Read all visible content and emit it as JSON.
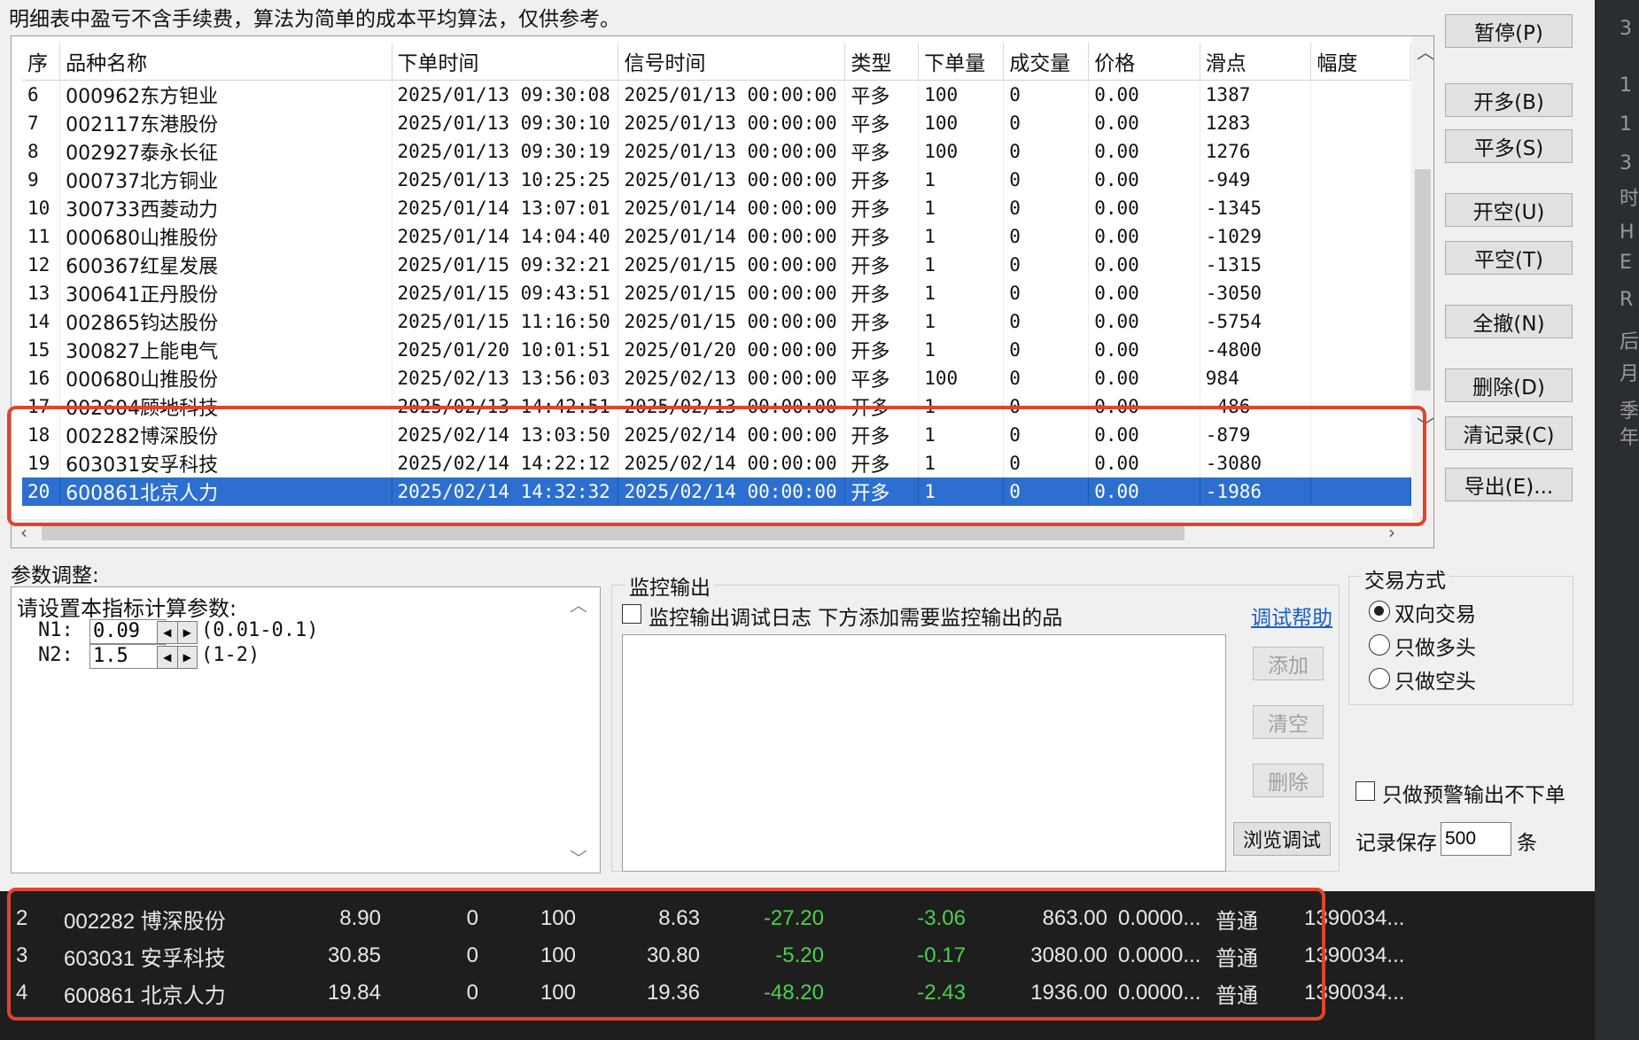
{
  "note": "明细表中盈亏不含手续费，算法为简单的成本平均算法，仅供参考。",
  "grid": {
    "headers": [
      "序",
      "品种名称",
      "下单时间",
      "信号时间",
      "类型",
      "下单量",
      "成交量",
      "价格",
      "滑点",
      "幅度"
    ],
    "rows": [
      {
        "idx": "6",
        "name": "000962东方钽业",
        "order_time": "2025/01/13 09:30:08",
        "signal_time": "2025/01/13 00:00:00",
        "type": "平多",
        "qty": "100",
        "filled": "0",
        "price": "0.00",
        "slip": "1387",
        "range": ""
      },
      {
        "idx": "7",
        "name": "002117东港股份",
        "order_time": "2025/01/13 09:30:10",
        "signal_time": "2025/01/13 00:00:00",
        "type": "平多",
        "qty": "100",
        "filled": "0",
        "price": "0.00",
        "slip": "1283",
        "range": ""
      },
      {
        "idx": "8",
        "name": "002927泰永长征",
        "order_time": "2025/01/13 09:30:19",
        "signal_time": "2025/01/13 00:00:00",
        "type": "平多",
        "qty": "100",
        "filled": "0",
        "price": "0.00",
        "slip": "1276",
        "range": ""
      },
      {
        "idx": "9",
        "name": "000737北方铜业",
        "order_time": "2025/01/13 10:25:25",
        "signal_time": "2025/01/13 00:00:00",
        "type": "开多",
        "qty": "1",
        "filled": "0",
        "price": "0.00",
        "slip": "-949",
        "range": ""
      },
      {
        "idx": "10",
        "name": "300733西菱动力",
        "order_time": "2025/01/14 13:07:01",
        "signal_time": "2025/01/14 00:00:00",
        "type": "开多",
        "qty": "1",
        "filled": "0",
        "price": "0.00",
        "slip": "-1345",
        "range": ""
      },
      {
        "idx": "11",
        "name": "000680山推股份",
        "order_time": "2025/01/14 14:04:40",
        "signal_time": "2025/01/14 00:00:00",
        "type": "开多",
        "qty": "1",
        "filled": "0",
        "price": "0.00",
        "slip": "-1029",
        "range": ""
      },
      {
        "idx": "12",
        "name": "600367红星发展",
        "order_time": "2025/01/15 09:32:21",
        "signal_time": "2025/01/15 00:00:00",
        "type": "开多",
        "qty": "1",
        "filled": "0",
        "price": "0.00",
        "slip": "-1315",
        "range": ""
      },
      {
        "idx": "13",
        "name": "300641正丹股份",
        "order_time": "2025/01/15 09:43:51",
        "signal_time": "2025/01/15 00:00:00",
        "type": "开多",
        "qty": "1",
        "filled": "0",
        "price": "0.00",
        "slip": "-3050",
        "range": ""
      },
      {
        "idx": "14",
        "name": "002865钧达股份",
        "order_time": "2025/01/15 11:16:50",
        "signal_time": "2025/01/15 00:00:00",
        "type": "开多",
        "qty": "1",
        "filled": "0",
        "price": "0.00",
        "slip": "-5754",
        "range": ""
      },
      {
        "idx": "15",
        "name": "300827上能电气",
        "order_time": "2025/01/20 10:01:51",
        "signal_time": "2025/01/20 00:00:00",
        "type": "开多",
        "qty": "1",
        "filled": "0",
        "price": "0.00",
        "slip": "-4800",
        "range": ""
      },
      {
        "idx": "16",
        "name": "000680山推股份",
        "order_time": "2025/02/13 13:56:03",
        "signal_time": "2025/02/13 00:00:00",
        "type": "平多",
        "qty": "100",
        "filled": "0",
        "price": "0.00",
        "slip": "984",
        "range": ""
      },
      {
        "idx": "17",
        "name": "002604顾地科技",
        "order_time": "2025/02/13 14:42:51",
        "signal_time": "2025/02/13 00:00:00",
        "type": "开多",
        "qty": "1",
        "filled": "0",
        "price": "0.00",
        "slip": "-486",
        "range": ""
      },
      {
        "idx": "18",
        "name": "002282博深股份",
        "order_time": "2025/02/14 13:03:50",
        "signal_time": "2025/02/14 00:00:00",
        "type": "开多",
        "qty": "1",
        "filled": "0",
        "price": "0.00",
        "slip": "-879",
        "range": ""
      },
      {
        "idx": "19",
        "name": "603031安孚科技",
        "order_time": "2025/02/14 14:22:12",
        "signal_time": "2025/02/14 00:00:00",
        "type": "开多",
        "qty": "1",
        "filled": "0",
        "price": "0.00",
        "slip": "-3080",
        "range": ""
      },
      {
        "idx": "20",
        "name": "600861北京人力",
        "order_time": "2025/02/14 14:32:32",
        "signal_time": "2025/02/14 00:00:00",
        "type": "开多",
        "qty": "1",
        "filled": "0",
        "price": "0.00",
        "slip": "-1986",
        "range": "",
        "selected": true
      }
    ]
  },
  "buttons": {
    "pause": "暂停(P)",
    "open_long": "开多(B)",
    "close_long": "平多(S)",
    "open_short": "开空(U)",
    "close_short": "平空(T)",
    "cancel_all": "全撤(N)",
    "delete": "删除(D)",
    "clear_records": "清记录(C)",
    "export": "导出(E)..."
  },
  "params": {
    "label": "参数调整:",
    "prompt": "请设置本指标计算参数:",
    "n1_label": "N1:",
    "n1_value": "0.09",
    "n1_range": "(0.01-0.1)",
    "n2_label": "N2:",
    "n2_value": "1.5",
    "n2_range": "(1-2)"
  },
  "monitor": {
    "label": "监控输出",
    "checkbox_label": "监控输出调试日志 下方添加需要监控输出的品",
    "help_link": "调试帮助",
    "add": "添加",
    "clear": "清空",
    "delete": "删除",
    "browse": "浏览调试"
  },
  "trade_mode": {
    "label": "交易方式",
    "options": [
      "双向交易",
      "只做多头",
      "只做空头"
    ],
    "selected": 0
  },
  "alert_only_label": "只做预警输出不下单",
  "record_keep": {
    "label": "记录保存",
    "value": "500",
    "unit": "条"
  },
  "positions": [
    {
      "idx": "2",
      "name": "002282 博深股份",
      "cost": "8.90",
      "c2": "0",
      "qty": "100",
      "price": "8.63",
      "pnl": "-27.20",
      "pct": "-3.06",
      "amt": "863.00",
      "ratio": "0.0000...",
      "kind": "普通",
      "acct": "1390034..."
    },
    {
      "idx": "3",
      "name": "603031 安孚科技",
      "cost": "30.85",
      "c2": "0",
      "qty": "100",
      "price": "30.80",
      "pnl": "-5.20",
      "pct": "-0.17",
      "amt": "3080.00",
      "ratio": "0.0000...",
      "kind": "普通",
      "acct": "1390034..."
    },
    {
      "idx": "4",
      "name": "600861 北京人力",
      "cost": "19.84",
      "c2": "0",
      "qty": "100",
      "price": "19.36",
      "pnl": "-48.20",
      "pct": "-2.43",
      "amt": "1936.00",
      "ratio": "0.0000...",
      "kind": "普通",
      "acct": "1390034..."
    }
  ],
  "right_edge_chars": [
    "3",
    "1",
    "1",
    "3",
    "时",
    "H",
    "E",
    "R",
    "后",
    "月",
    "季",
    "年"
  ],
  "colors": {
    "selection": "#2c6fd1",
    "highlight_box": "#e0452b",
    "gain_loss": "#4bd14b"
  }
}
